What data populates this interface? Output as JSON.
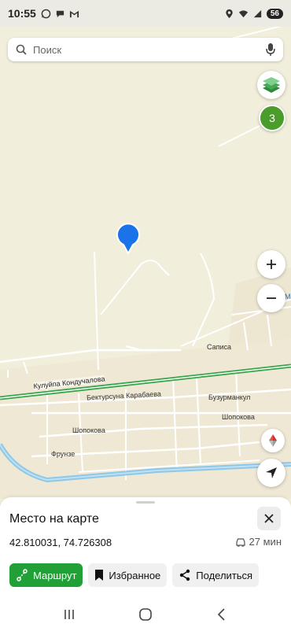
{
  "status_bar": {
    "time": "10:55",
    "battery": "56"
  },
  "search": {
    "placeholder": "Поиск"
  },
  "map": {
    "cluster_count": "3",
    "street_labels": [
      {
        "text": "Саписа"
      },
      {
        "text": "Кулуйпа Кондучалова"
      },
      {
        "text": "Бектурсуна Карабаева"
      },
      {
        "text": "Бузурманкул"
      },
      {
        "text": "Шопокова"
      },
      {
        "text": "Шопокова"
      },
      {
        "text": "Фрунзе"
      },
      {
        "text": "Меч"
      }
    ]
  },
  "sheet": {
    "title": "Место на карте",
    "coordinates": "42.810031, 74.726308",
    "eta": "27 мин",
    "route_label": "Маршрут",
    "favorite_label": "Избранное",
    "share_label": "Поделиться"
  },
  "colors": {
    "accent_green": "#22a038",
    "pin_blue": "#1a73e8",
    "road_green": "#3aa64c",
    "river_blue": "#8ec8e8"
  }
}
